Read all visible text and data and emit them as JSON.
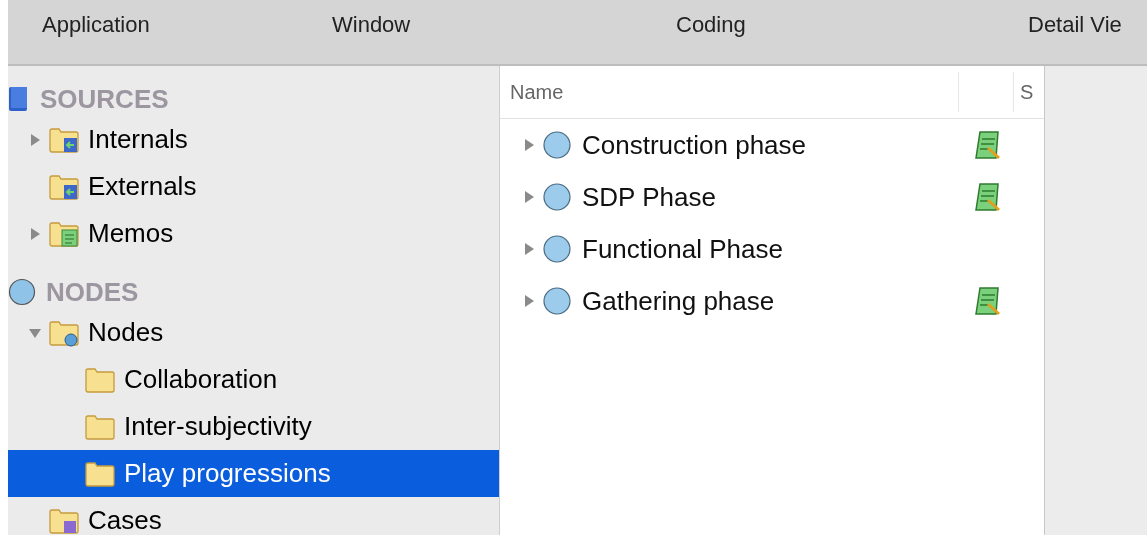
{
  "toolbar": {
    "items": [
      "Application",
      "Window",
      "Coding",
      "Detail Vie"
    ]
  },
  "sidebar": {
    "sections": [
      {
        "title": "SOURCES",
        "kind": "sources",
        "items": [
          {
            "label": "Internals",
            "kind": "internals",
            "expanded": false,
            "selected": false
          },
          {
            "label": "Externals",
            "kind": "externals",
            "selected": false
          },
          {
            "label": "Memos",
            "kind": "memos",
            "expanded": false,
            "selected": false
          }
        ]
      },
      {
        "title": "NODES",
        "kind": "nodes",
        "items": [
          {
            "label": "Nodes",
            "kind": "nodes",
            "expanded": true,
            "selected": false,
            "children": [
              {
                "label": "Collaboration",
                "selected": false
              },
              {
                "label": "Inter-subjectivity",
                "selected": false
              },
              {
                "label": "Play progressions",
                "selected": true
              }
            ]
          },
          {
            "label": "Cases",
            "kind": "cases",
            "selected": false
          }
        ]
      }
    ]
  },
  "table": {
    "columns": [
      "Name",
      "",
      "S"
    ],
    "rows": [
      {
        "name": "Construction phase",
        "memo": true
      },
      {
        "name": "SDP Phase",
        "memo": true
      },
      {
        "name": "Functional Phase",
        "memo": false
      },
      {
        "name": "Gathering phase",
        "memo": true
      }
    ]
  }
}
